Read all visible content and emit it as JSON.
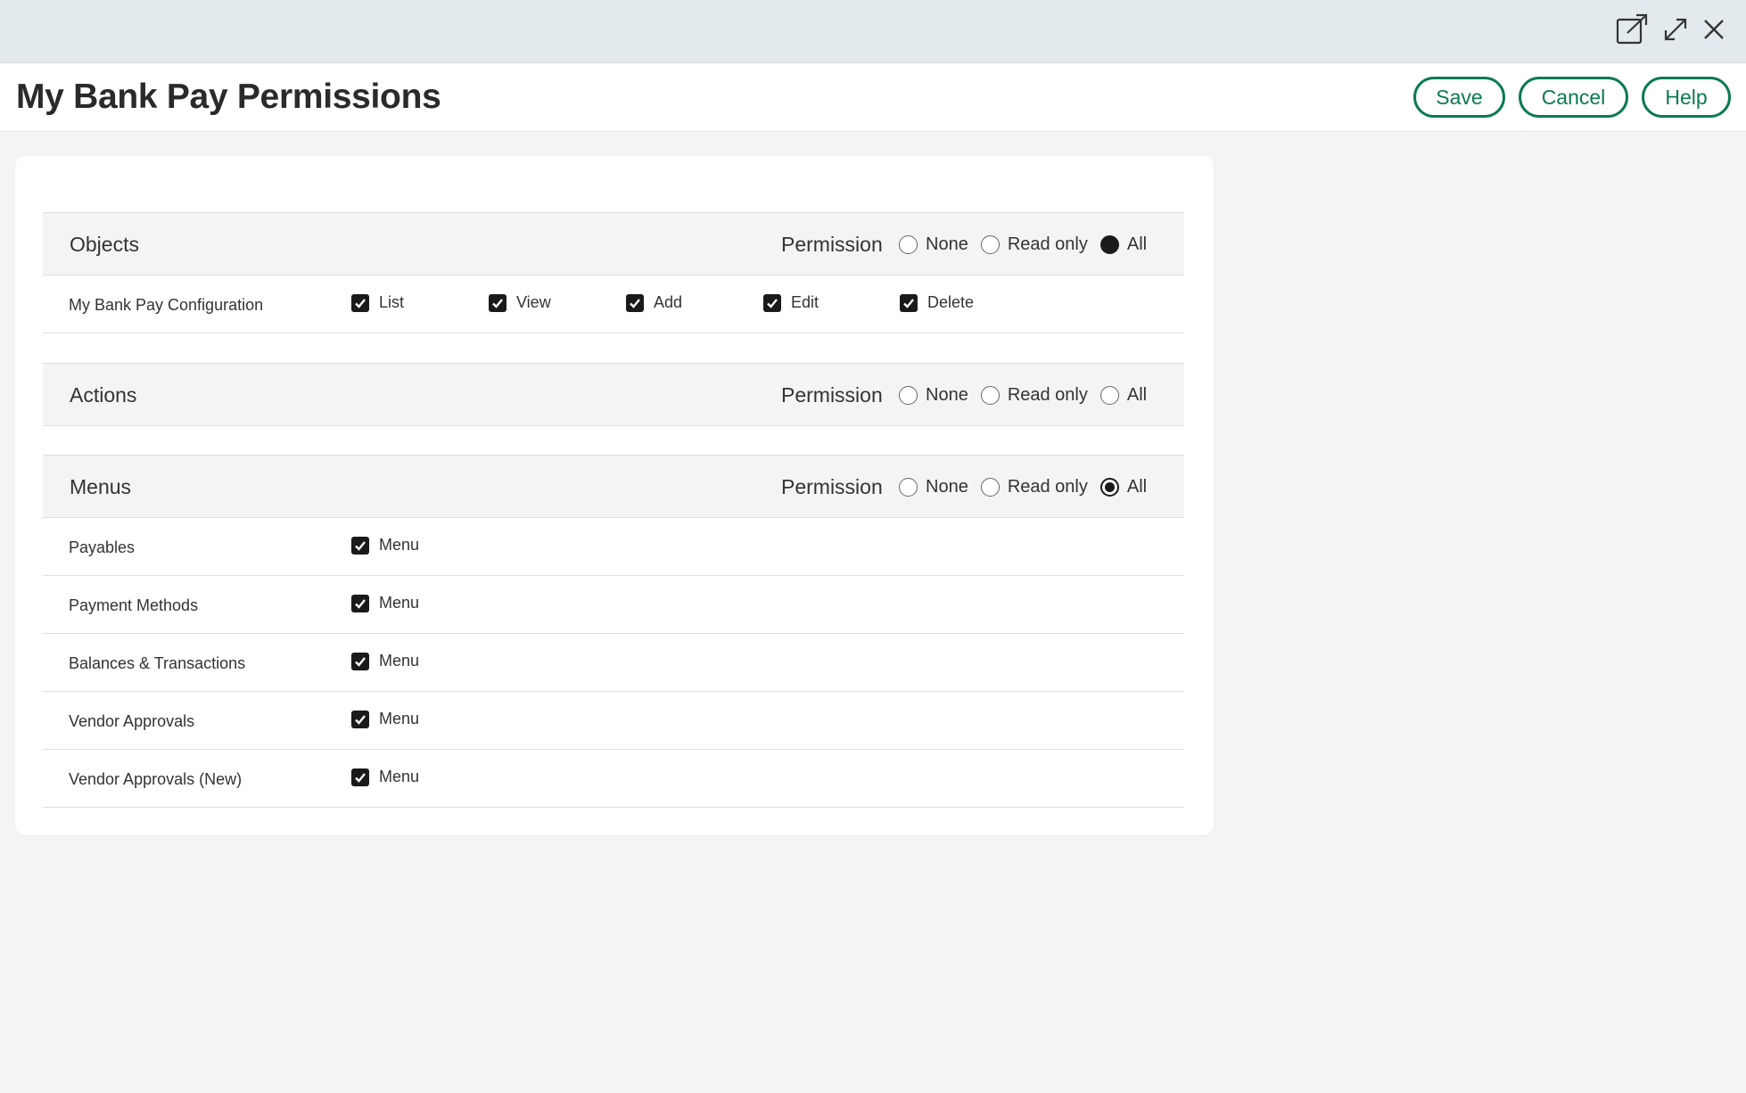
{
  "window": {
    "icons": [
      "open-external-icon",
      "expand-icon",
      "close-icon"
    ]
  },
  "header": {
    "title": "My Bank Pay Permissions",
    "save_label": "Save",
    "cancel_label": "Cancel",
    "help_label": "Help"
  },
  "colors": {
    "accent": "#0b7a4f",
    "topbar": "#e3eaed",
    "background": "#f3f4f6"
  },
  "permission_options": [
    "None",
    "Read only",
    "All"
  ],
  "objects": {
    "title": "Objects",
    "permission_label": "Permission",
    "selected": "All",
    "rows": [
      {
        "label": "My Bank Pay Configuration",
        "checks": [
          {
            "label": "List",
            "checked": true
          },
          {
            "label": "View",
            "checked": true
          },
          {
            "label": "Add",
            "checked": true
          },
          {
            "label": "Edit",
            "checked": true
          },
          {
            "label": "Delete",
            "checked": true
          }
        ]
      }
    ]
  },
  "actions": {
    "title": "Actions",
    "permission_label": "Permission",
    "selected": null
  },
  "menus": {
    "title": "Menus",
    "permission_label": "Permission",
    "selected": "All",
    "rows": [
      {
        "label": "Payables",
        "check_label": "Menu",
        "checked": true
      },
      {
        "label": "Payment Methods",
        "check_label": "Menu",
        "checked": true
      },
      {
        "label": "Balances & Transactions",
        "check_label": "Menu",
        "checked": true
      },
      {
        "label": "Vendor Approvals",
        "check_label": "Menu",
        "checked": true
      },
      {
        "label": "Vendor Approvals (New)",
        "check_label": "Menu",
        "checked": true
      }
    ]
  }
}
